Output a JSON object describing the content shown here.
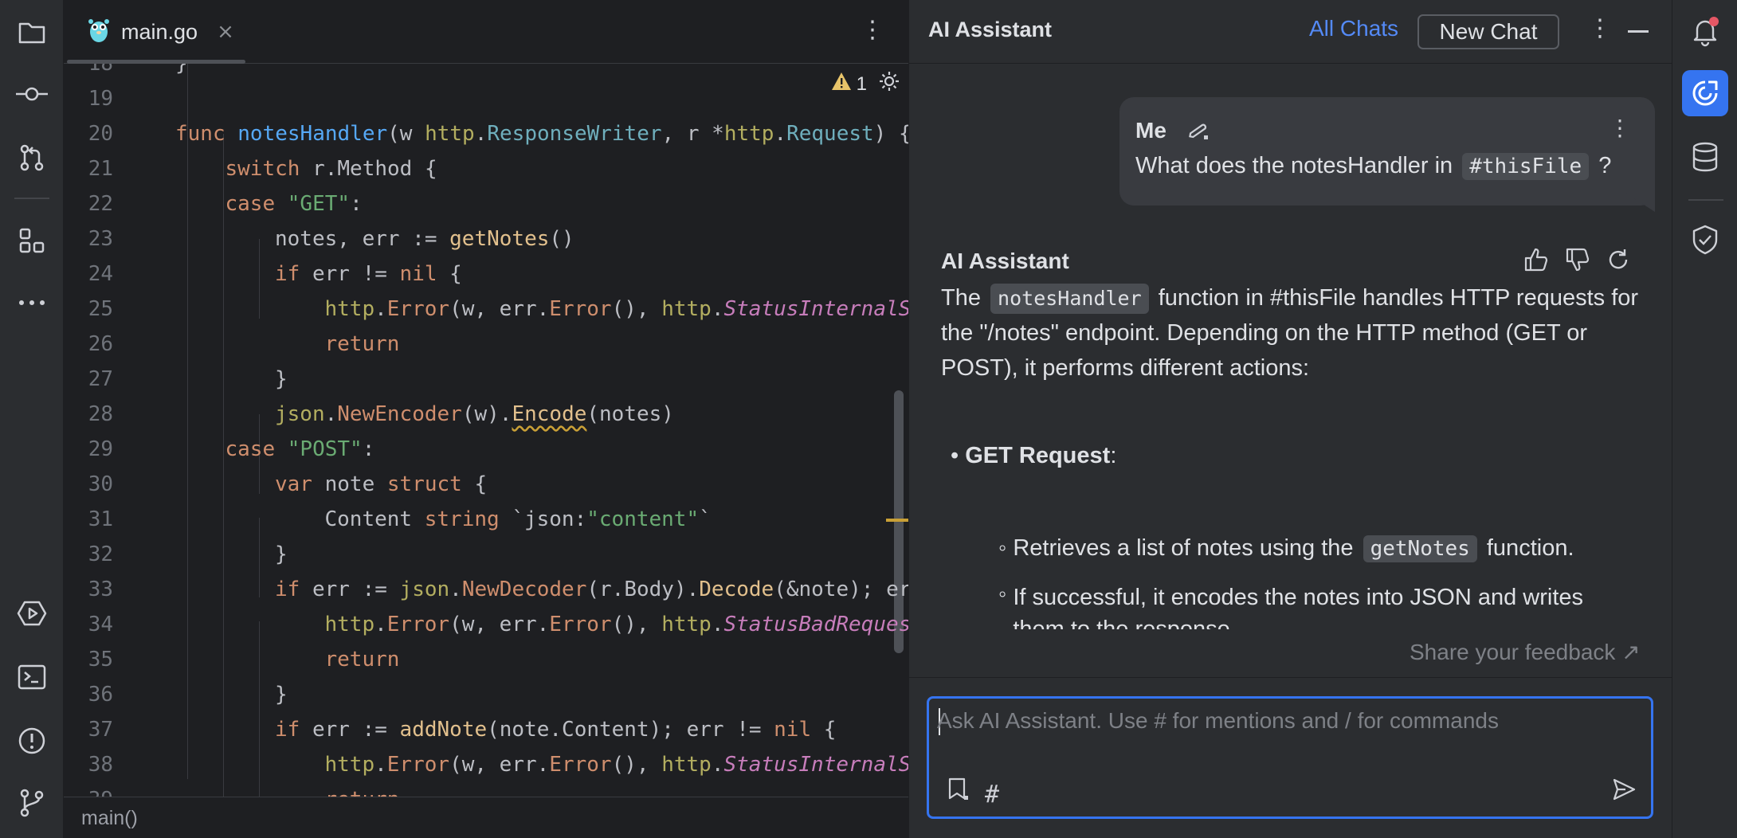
{
  "editor": {
    "tab_label": "main.go",
    "tab_close": "×",
    "warning_count": "1",
    "status_text": "main()",
    "lines": [
      {
        "num": "18",
        "indent": 0,
        "tokens": [
          {
            "t": "}",
            "c": ""
          }
        ]
      },
      {
        "num": "19",
        "indent": 0,
        "tokens": []
      },
      {
        "num": "20",
        "indent": 0,
        "tokens": [
          {
            "t": "func ",
            "c": "kw"
          },
          {
            "t": "notesHandler",
            "c": "fn"
          },
          {
            "t": "(w ",
            "c": ""
          },
          {
            "t": "http",
            "c": "pkg"
          },
          {
            "t": ".",
            "c": ""
          },
          {
            "t": "ResponseWriter",
            "c": "typ"
          },
          {
            "t": ", r *",
            "c": ""
          },
          {
            "t": "http",
            "c": "pkg"
          },
          {
            "t": ".",
            "c": ""
          },
          {
            "t": "Request",
            "c": "typ"
          },
          {
            "t": ") {",
            "c": ""
          }
        ]
      },
      {
        "num": "21",
        "indent": 1,
        "tokens": [
          {
            "t": "switch ",
            "c": "kw"
          },
          {
            "t": "r.Method {",
            "c": ""
          }
        ]
      },
      {
        "num": "22",
        "indent": 1,
        "tokens": [
          {
            "t": "case ",
            "c": "kw"
          },
          {
            "t": "\"GET\"",
            "c": "str"
          },
          {
            "t": ":",
            "c": ""
          }
        ]
      },
      {
        "num": "23",
        "indent": 2,
        "tokens": [
          {
            "t": "notes, err := ",
            "c": ""
          },
          {
            "t": "getNotes",
            "c": "call"
          },
          {
            "t": "()",
            "c": ""
          }
        ]
      },
      {
        "num": "24",
        "indent": 2,
        "tokens": [
          {
            "t": "if ",
            "c": "kw"
          },
          {
            "t": "err != ",
            "c": ""
          },
          {
            "t": "nil",
            "c": "kw"
          },
          {
            "t": " {",
            "c": ""
          }
        ]
      },
      {
        "num": "25",
        "indent": 3,
        "tokens": [
          {
            "t": "http",
            "c": "pkg"
          },
          {
            "t": ".",
            "c": ""
          },
          {
            "t": "Error",
            "c": "orange"
          },
          {
            "t": "(w, err.",
            "c": ""
          },
          {
            "t": "Error",
            "c": "orange"
          },
          {
            "t": "(), ",
            "c": ""
          },
          {
            "t": "http",
            "c": "pkg"
          },
          {
            "t": ".",
            "c": ""
          },
          {
            "t": "StatusInternalServerError",
            "c": "cst"
          }
        ]
      },
      {
        "num": "26",
        "indent": 3,
        "tokens": [
          {
            "t": "return",
            "c": "kw"
          }
        ]
      },
      {
        "num": "27",
        "indent": 2,
        "tokens": [
          {
            "t": "}",
            "c": ""
          }
        ]
      },
      {
        "num": "28",
        "indent": 2,
        "tokens": [
          {
            "t": "json",
            "c": "pkg"
          },
          {
            "t": ".",
            "c": ""
          },
          {
            "t": "NewEncoder",
            "c": "orange"
          },
          {
            "t": "(w).",
            "c": ""
          },
          {
            "t": "Encode",
            "c": "call squig"
          },
          {
            "t": "(notes)",
            "c": ""
          }
        ]
      },
      {
        "num": "29",
        "indent": 1,
        "tokens": [
          {
            "t": "case ",
            "c": "kw"
          },
          {
            "t": "\"POST\"",
            "c": "str"
          },
          {
            "t": ":",
            "c": ""
          }
        ]
      },
      {
        "num": "30",
        "indent": 2,
        "tokens": [
          {
            "t": "var ",
            "c": "kw"
          },
          {
            "t": "note ",
            "c": ""
          },
          {
            "t": "struct ",
            "c": "kw"
          },
          {
            "t": "{",
            "c": ""
          }
        ]
      },
      {
        "num": "31",
        "indent": 3,
        "tokens": [
          {
            "t": "Content ",
            "c": ""
          },
          {
            "t": "string ",
            "c": "kw"
          },
          {
            "t": "`json:",
            "c": ""
          },
          {
            "t": "\"content\"",
            "c": "str"
          },
          {
            "t": "`",
            "c": ""
          }
        ]
      },
      {
        "num": "32",
        "indent": 2,
        "tokens": [
          {
            "t": "}",
            "c": ""
          }
        ]
      },
      {
        "num": "33",
        "indent": 2,
        "tokens": [
          {
            "t": "if ",
            "c": "kw"
          },
          {
            "t": "err := ",
            "c": ""
          },
          {
            "t": "json",
            "c": "pkg"
          },
          {
            "t": ".",
            "c": ""
          },
          {
            "t": "NewDecoder",
            "c": "orange"
          },
          {
            "t": "(r.Body).",
            "c": ""
          },
          {
            "t": "Decode",
            "c": "call"
          },
          {
            "t": "(&note); err != nil {",
            "c": ""
          }
        ]
      },
      {
        "num": "34",
        "indent": 3,
        "tokens": [
          {
            "t": "http",
            "c": "pkg"
          },
          {
            "t": ".",
            "c": ""
          },
          {
            "t": "Error",
            "c": "orange"
          },
          {
            "t": "(w, err.",
            "c": ""
          },
          {
            "t": "Error",
            "c": "orange"
          },
          {
            "t": "(), ",
            "c": ""
          },
          {
            "t": "http",
            "c": "pkg"
          },
          {
            "t": ".",
            "c": ""
          },
          {
            "t": "StatusBadRequest",
            "c": "cst"
          }
        ]
      },
      {
        "num": "35",
        "indent": 3,
        "tokens": [
          {
            "t": "return",
            "c": "kw"
          }
        ]
      },
      {
        "num": "36",
        "indent": 2,
        "tokens": [
          {
            "t": "}",
            "c": ""
          }
        ]
      },
      {
        "num": "37",
        "indent": 2,
        "tokens": [
          {
            "t": "if ",
            "c": "kw"
          },
          {
            "t": "err := ",
            "c": ""
          },
          {
            "t": "addNote",
            "c": "call"
          },
          {
            "t": "(note.Content); err != ",
            "c": ""
          },
          {
            "t": "nil",
            "c": "kw"
          },
          {
            "t": " {",
            "c": ""
          }
        ]
      },
      {
        "num": "38",
        "indent": 3,
        "tokens": [
          {
            "t": "http",
            "c": "pkg"
          },
          {
            "t": ".",
            "c": ""
          },
          {
            "t": "Error",
            "c": "orange"
          },
          {
            "t": "(w, err.",
            "c": ""
          },
          {
            "t": "Error",
            "c": "orange"
          },
          {
            "t": "(), ",
            "c": ""
          },
          {
            "t": "http",
            "c": "pkg"
          },
          {
            "t": ".",
            "c": ""
          },
          {
            "t": "StatusInternalServerError",
            "c": "cst"
          }
        ]
      },
      {
        "num": "39",
        "indent": 3,
        "tokens": [
          {
            "t": "return",
            "c": "kw"
          }
        ]
      }
    ]
  },
  "assistant": {
    "title": "AI Assistant",
    "all_chats": "All Chats",
    "new_chat": "New Chat",
    "user_name": "Me",
    "question_pre": "What does the notesHandler in",
    "question_chip": "#thisFile",
    "question_post": "?",
    "answer_author": "AI Assistant",
    "answer_pre": "The",
    "answer_chip": "notesHandler",
    "answer_post": "function in #thisFile handles HTTP requests for the \"/notes\" endpoint. Depending on the HTTP method (GET or POST), it performs different actions:",
    "bullet_title": "GET Request",
    "bullet_colon": ":",
    "sub1_pre": "Retrieves a list of notes using the",
    "sub1_chip": "getNotes",
    "sub1_post": "function.",
    "sub2": "If successful, it encodes the notes into JSON and writes them to the response.",
    "feedback": "Share your feedback ↗",
    "input_placeholder": "Ask AI Assistant. Use # for mentions and / for commands",
    "hash_symbol": "#"
  },
  "icons": {
    "left_strip": [
      "folder-icon",
      "commit-icon",
      "pull-requests-icon",
      "structure-icon",
      "more-icon",
      "run-icon",
      "terminal-icon",
      "problems-icon",
      "git-icon"
    ],
    "right_strip": [
      "notifications-icon",
      "ai-assistant-icon",
      "database-icon",
      "security-icon"
    ]
  },
  "colors": {
    "accent": "#3574f0",
    "link": "#548af7",
    "warning": "#e8c46a",
    "notification_dot": "#e55765"
  }
}
